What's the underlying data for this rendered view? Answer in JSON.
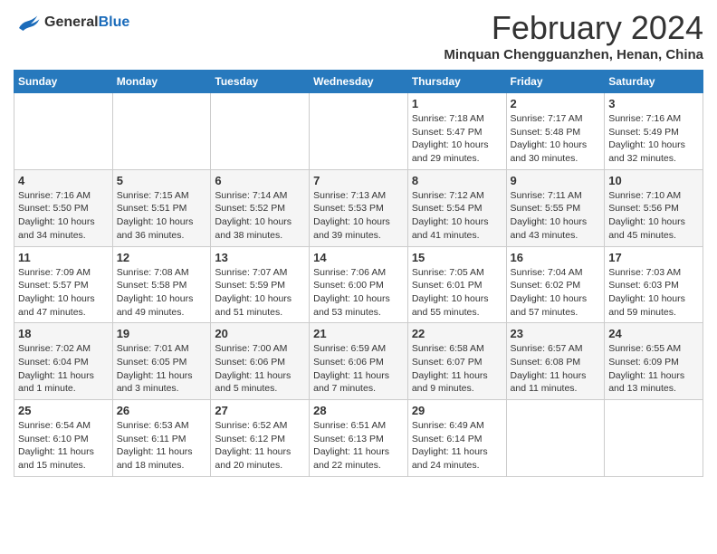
{
  "logo": {
    "line1": "General",
    "line2": "Blue"
  },
  "title": "February 2024",
  "location": "Minquan Chengguanzhen, Henan, China",
  "days_of_week": [
    "Sunday",
    "Monday",
    "Tuesday",
    "Wednesday",
    "Thursday",
    "Friday",
    "Saturday"
  ],
  "weeks": [
    [
      {
        "day": "",
        "info": ""
      },
      {
        "day": "",
        "info": ""
      },
      {
        "day": "",
        "info": ""
      },
      {
        "day": "",
        "info": ""
      },
      {
        "day": "1",
        "info": "Sunrise: 7:18 AM\nSunset: 5:47 PM\nDaylight: 10 hours and 29 minutes."
      },
      {
        "day": "2",
        "info": "Sunrise: 7:17 AM\nSunset: 5:48 PM\nDaylight: 10 hours and 30 minutes."
      },
      {
        "day": "3",
        "info": "Sunrise: 7:16 AM\nSunset: 5:49 PM\nDaylight: 10 hours and 32 minutes."
      }
    ],
    [
      {
        "day": "4",
        "info": "Sunrise: 7:16 AM\nSunset: 5:50 PM\nDaylight: 10 hours and 34 minutes."
      },
      {
        "day": "5",
        "info": "Sunrise: 7:15 AM\nSunset: 5:51 PM\nDaylight: 10 hours and 36 minutes."
      },
      {
        "day": "6",
        "info": "Sunrise: 7:14 AM\nSunset: 5:52 PM\nDaylight: 10 hours and 38 minutes."
      },
      {
        "day": "7",
        "info": "Sunrise: 7:13 AM\nSunset: 5:53 PM\nDaylight: 10 hours and 39 minutes."
      },
      {
        "day": "8",
        "info": "Sunrise: 7:12 AM\nSunset: 5:54 PM\nDaylight: 10 hours and 41 minutes."
      },
      {
        "day": "9",
        "info": "Sunrise: 7:11 AM\nSunset: 5:55 PM\nDaylight: 10 hours and 43 minutes."
      },
      {
        "day": "10",
        "info": "Sunrise: 7:10 AM\nSunset: 5:56 PM\nDaylight: 10 hours and 45 minutes."
      }
    ],
    [
      {
        "day": "11",
        "info": "Sunrise: 7:09 AM\nSunset: 5:57 PM\nDaylight: 10 hours and 47 minutes."
      },
      {
        "day": "12",
        "info": "Sunrise: 7:08 AM\nSunset: 5:58 PM\nDaylight: 10 hours and 49 minutes."
      },
      {
        "day": "13",
        "info": "Sunrise: 7:07 AM\nSunset: 5:59 PM\nDaylight: 10 hours and 51 minutes."
      },
      {
        "day": "14",
        "info": "Sunrise: 7:06 AM\nSunset: 6:00 PM\nDaylight: 10 hours and 53 minutes."
      },
      {
        "day": "15",
        "info": "Sunrise: 7:05 AM\nSunset: 6:01 PM\nDaylight: 10 hours and 55 minutes."
      },
      {
        "day": "16",
        "info": "Sunrise: 7:04 AM\nSunset: 6:02 PM\nDaylight: 10 hours and 57 minutes."
      },
      {
        "day": "17",
        "info": "Sunrise: 7:03 AM\nSunset: 6:03 PM\nDaylight: 10 hours and 59 minutes."
      }
    ],
    [
      {
        "day": "18",
        "info": "Sunrise: 7:02 AM\nSunset: 6:04 PM\nDaylight: 11 hours and 1 minute."
      },
      {
        "day": "19",
        "info": "Sunrise: 7:01 AM\nSunset: 6:05 PM\nDaylight: 11 hours and 3 minutes."
      },
      {
        "day": "20",
        "info": "Sunrise: 7:00 AM\nSunset: 6:06 PM\nDaylight: 11 hours and 5 minutes."
      },
      {
        "day": "21",
        "info": "Sunrise: 6:59 AM\nSunset: 6:06 PM\nDaylight: 11 hours and 7 minutes."
      },
      {
        "day": "22",
        "info": "Sunrise: 6:58 AM\nSunset: 6:07 PM\nDaylight: 11 hours and 9 minutes."
      },
      {
        "day": "23",
        "info": "Sunrise: 6:57 AM\nSunset: 6:08 PM\nDaylight: 11 hours and 11 minutes."
      },
      {
        "day": "24",
        "info": "Sunrise: 6:55 AM\nSunset: 6:09 PM\nDaylight: 11 hours and 13 minutes."
      }
    ],
    [
      {
        "day": "25",
        "info": "Sunrise: 6:54 AM\nSunset: 6:10 PM\nDaylight: 11 hours and 15 minutes."
      },
      {
        "day": "26",
        "info": "Sunrise: 6:53 AM\nSunset: 6:11 PM\nDaylight: 11 hours and 18 minutes."
      },
      {
        "day": "27",
        "info": "Sunrise: 6:52 AM\nSunset: 6:12 PM\nDaylight: 11 hours and 20 minutes."
      },
      {
        "day": "28",
        "info": "Sunrise: 6:51 AM\nSunset: 6:13 PM\nDaylight: 11 hours and 22 minutes."
      },
      {
        "day": "29",
        "info": "Sunrise: 6:49 AM\nSunset: 6:14 PM\nDaylight: 11 hours and 24 minutes."
      },
      {
        "day": "",
        "info": ""
      },
      {
        "day": "",
        "info": ""
      }
    ]
  ]
}
